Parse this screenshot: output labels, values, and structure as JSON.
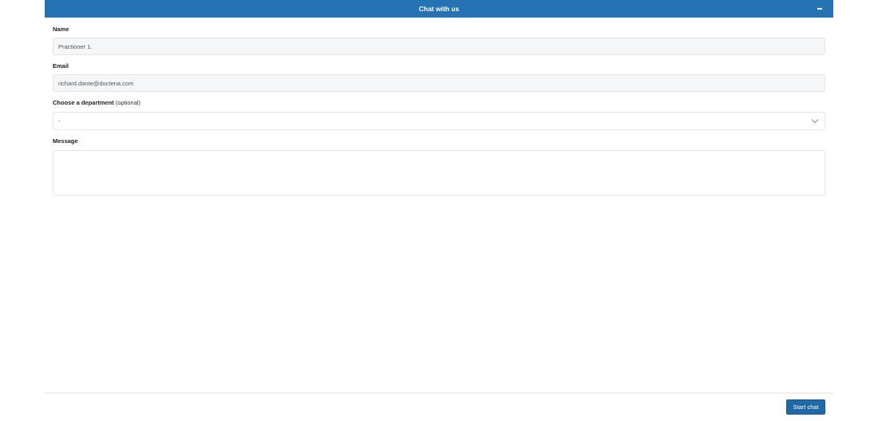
{
  "header": {
    "title": "Chat with us",
    "minimize_icon": "minimize-icon"
  },
  "form": {
    "name": {
      "label": "Name",
      "value": "Practioner 1."
    },
    "email": {
      "label": "Email",
      "value": "richard.dante@doctena.com"
    },
    "department": {
      "label": "Choose a department",
      "optional": "(optional)",
      "selected": "-",
      "icon": "chevron-down-icon"
    },
    "message": {
      "label": "Message",
      "value": ""
    }
  },
  "footer": {
    "start_label": "Start chat"
  },
  "colors": {
    "header_bg": "#2673b4",
    "button_bg": "#2168a6"
  }
}
